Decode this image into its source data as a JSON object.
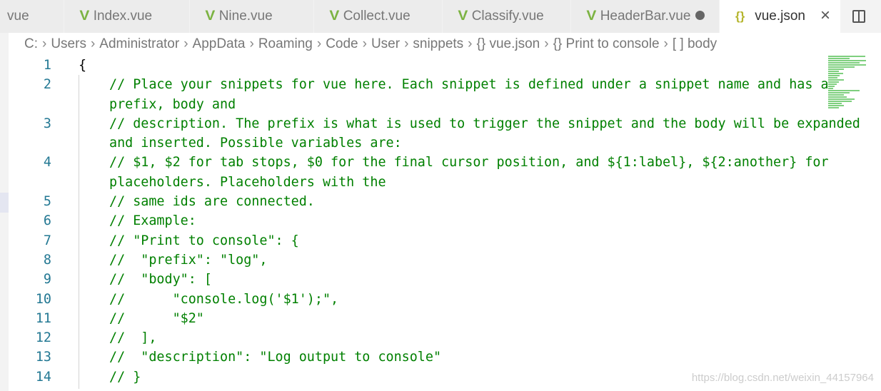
{
  "tabs": [
    {
      "label": "vue",
      "icon": "vue-icon"
    },
    {
      "label": "Index.vue",
      "icon": "vue-icon"
    },
    {
      "label": "Nine.vue",
      "icon": "vue-icon"
    },
    {
      "label": "Collect.vue",
      "icon": "vue-icon"
    },
    {
      "label": "Classify.vue",
      "icon": "vue-icon"
    },
    {
      "label": "HeaderBar.vue",
      "icon": "vue-icon",
      "modified": true
    },
    {
      "label": "vue.json",
      "icon": "json-braces-icon",
      "active": true
    }
  ],
  "icons": {
    "vue": "V",
    "json": "{}",
    "close": "×",
    "more": "···"
  },
  "breadcrumb": [
    "C:",
    "Users",
    "Administrator",
    "AppData",
    "Roaming",
    "Code",
    "User",
    "snippets",
    "{} vue.json",
    "{} Print to console",
    "[ ] body"
  ],
  "code": [
    {
      "n": "1",
      "t": "{",
      "c": false
    },
    {
      "n": "2",
      "t": "// Place your snippets for vue here. Each snippet is defined under a snippet name and has a prefix, body and",
      "c": true
    },
    {
      "n": "3",
      "t": "// description. The prefix is what is used to trigger the snippet and the body will be expanded and inserted. Possible variables are:",
      "c": true
    },
    {
      "n": "4",
      "t": "// $1, $2 for tab stops, $0 for the final cursor position, and ${1:label}, ${2:another} for placeholders. Placeholders with the",
      "c": true
    },
    {
      "n": "5",
      "t": "// same ids are connected.",
      "c": true
    },
    {
      "n": "6",
      "t": "// Example:",
      "c": true
    },
    {
      "n": "7",
      "t": "// \"Print to console\": {",
      "c": true
    },
    {
      "n": "8",
      "t": "//  \"prefix\": \"log\",",
      "c": true
    },
    {
      "n": "9",
      "t": "//  \"body\": [",
      "c": true
    },
    {
      "n": "10",
      "t": "//      \"console.log('$1');\",",
      "c": true
    },
    {
      "n": "11",
      "t": "//      \"$2\"",
      "c": true
    },
    {
      "n": "12",
      "t": "//  ],",
      "c": true
    },
    {
      "n": "13",
      "t": "//  \"description\": \"Log output to console\"",
      "c": true
    },
    {
      "n": "14",
      "t": "// }",
      "c": true
    }
  ],
  "watermark": "https://blog.csdn.net/weixin_44157964"
}
